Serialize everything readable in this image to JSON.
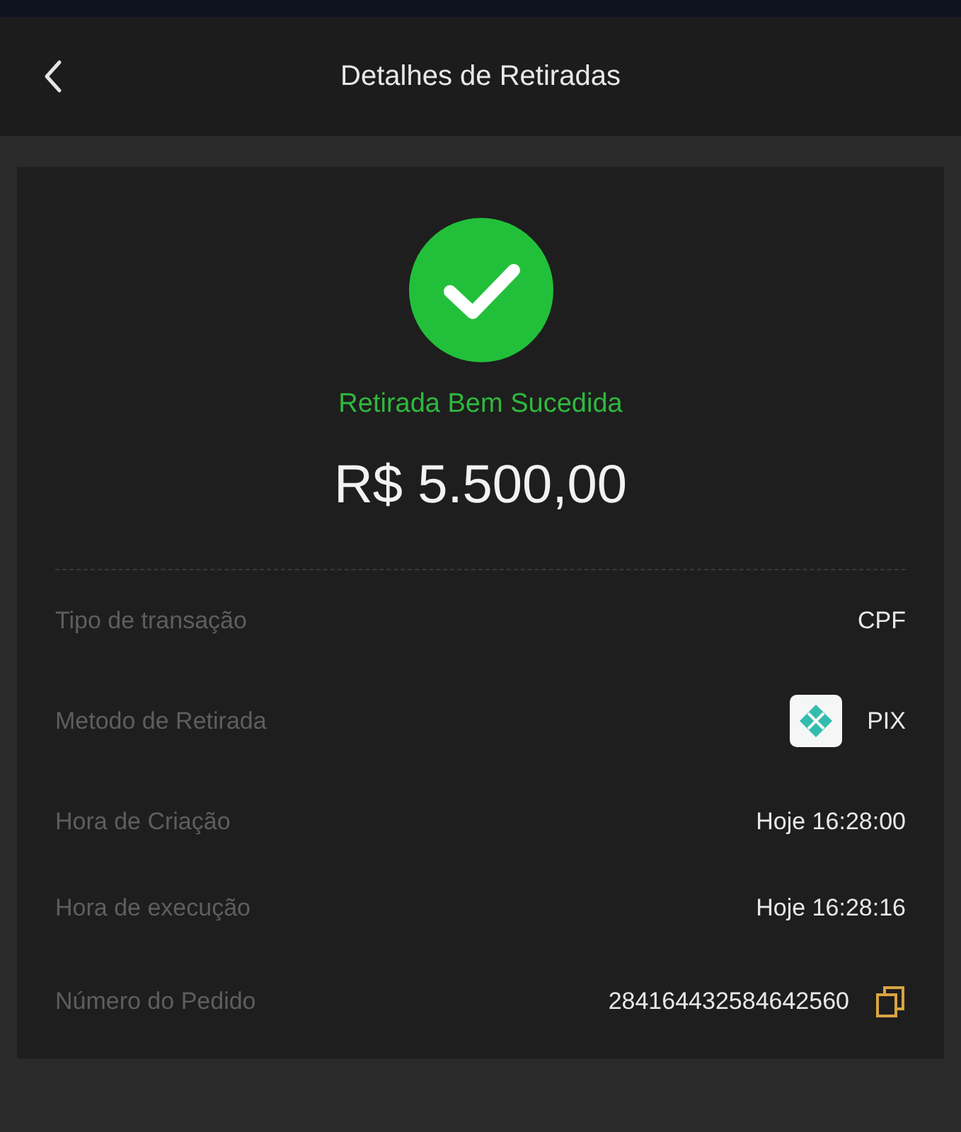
{
  "header": {
    "title": "Detalhes de Retiradas"
  },
  "status": {
    "label": "Retirada Bem Sucedida",
    "amount": "R$ 5.500,00"
  },
  "details": [
    {
      "label": "Tipo de transação",
      "value": "CPF",
      "kind": "text"
    },
    {
      "label": "Metodo de Retirada",
      "value": "PIX",
      "kind": "method"
    },
    {
      "label": "Hora de Criação",
      "value": "Hoje 16:28:00",
      "kind": "text"
    },
    {
      "label": "Hora de execução",
      "value": "Hoje 16:28:16",
      "kind": "text"
    },
    {
      "label": "Número do Pedido",
      "value": "284164432584642560",
      "kind": "copy"
    }
  ]
}
